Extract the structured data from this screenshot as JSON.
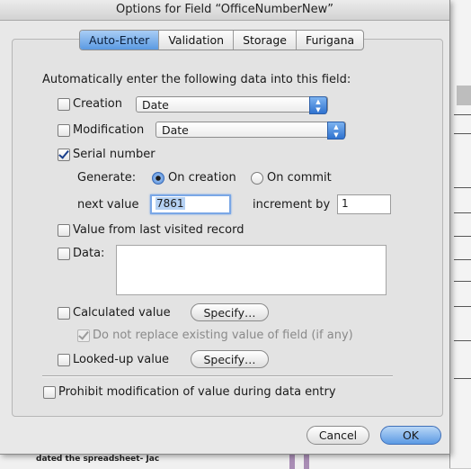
{
  "window": {
    "title": "Options for Field “OfficeNumberNew”"
  },
  "tabs": [
    {
      "label": "Auto-Enter",
      "active": true
    },
    {
      "label": "Validation",
      "active": false
    },
    {
      "label": "Storage",
      "active": false
    },
    {
      "label": "Furigana",
      "active": false
    }
  ],
  "intro_text": "Automatically enter the following data into this field:",
  "creation": {
    "label": "Creation",
    "checked": false,
    "select_value": "Date"
  },
  "modification": {
    "label": "Modification",
    "checked": false,
    "select_value": "Date"
  },
  "serial": {
    "label": "Serial number",
    "checked": true,
    "generate_label": "Generate:",
    "on_creation_label": "On creation",
    "on_commit_label": "On commit",
    "selected": "On creation",
    "next_value_label": "next value",
    "next_value": "7861",
    "increment_label": "increment by",
    "increment_value": "1"
  },
  "last_visited": {
    "label": "Value from last visited record",
    "checked": false
  },
  "data_option": {
    "label": "Data:",
    "checked": false,
    "value": ""
  },
  "calculated": {
    "label": "Calculated value",
    "checked": false,
    "specify_label": "Specify…",
    "do_not_replace_label": "Do not replace existing value of field (if any)",
    "do_not_replace_checked": true
  },
  "looked_up": {
    "label": "Looked-up value",
    "checked": false,
    "specify_label": "Specify…"
  },
  "prohibit": {
    "label": "Prohibit modification of value during data entry",
    "checked": false
  },
  "buttons": {
    "cancel": "Cancel",
    "ok": "OK"
  },
  "background": {
    "bottom_text": "dated the spreadsheet- Jac"
  },
  "colors": {
    "accent": "#5b9ae2",
    "window_bg": "#e8e8e8"
  }
}
